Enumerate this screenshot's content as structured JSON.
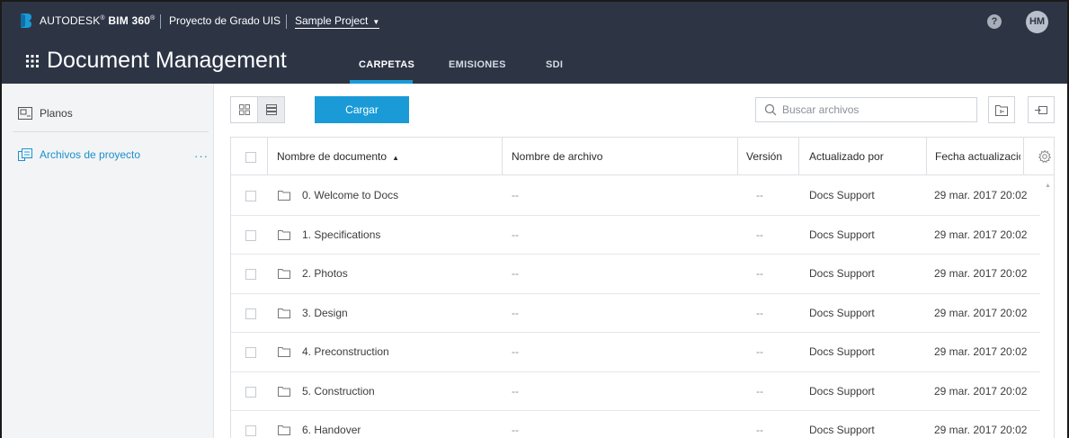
{
  "header": {
    "brand_prefix": "AUTODESK",
    "brand_product": "BIM 360",
    "brand_mark": "®",
    "project_group": "Proyecto de Grado UIS",
    "project_selector": "Sample Project",
    "help_glyph": "?",
    "user_initials": "HM",
    "app_title": "Document Management",
    "tabs": [
      {
        "label": "CARPETAS",
        "active": true
      },
      {
        "label": "EMISIONES",
        "active": false
      },
      {
        "label": "SDI",
        "active": false
      }
    ],
    "colors": {
      "header_bg": "#2d3545",
      "accent": "#1a9ad6"
    }
  },
  "sidebar": {
    "items": [
      {
        "label": "Planos",
        "icon": "sheets-icon"
      },
      {
        "label": "Archivos de proyecto",
        "icon": "project-files-icon",
        "active": true
      }
    ],
    "more_glyph": "···"
  },
  "toolbar": {
    "upload_label": "Cargar",
    "search_placeholder": "Buscar archivos"
  },
  "table": {
    "columns": [
      {
        "label": "Nombre de documento",
        "sorted": "asc"
      },
      {
        "label": "Nombre de archivo"
      },
      {
        "label": "Versión"
      },
      {
        "label": "Actualizado por"
      },
      {
        "label": "Fecha actualización"
      }
    ],
    "rows": [
      {
        "name": "0. Welcome to Docs",
        "file": "--",
        "version": "--",
        "updated_by": "Docs Support",
        "date": "29 mar. 2017 20:02"
      },
      {
        "name": "1. Specifications",
        "file": "--",
        "version": "--",
        "updated_by": "Docs Support",
        "date": "29 mar. 2017 20:02"
      },
      {
        "name": "2. Photos",
        "file": "--",
        "version": "--",
        "updated_by": "Docs Support",
        "date": "29 mar. 2017 20:02"
      },
      {
        "name": "3. Design",
        "file": "--",
        "version": "--",
        "updated_by": "Docs Support",
        "date": "29 mar. 2017 20:02"
      },
      {
        "name": "4. Preconstruction",
        "file": "--",
        "version": "--",
        "updated_by": "Docs Support",
        "date": "29 mar. 2017 20:02"
      },
      {
        "name": "5. Construction",
        "file": "--",
        "version": "--",
        "updated_by": "Docs Support",
        "date": "29 mar. 2017 20:02"
      },
      {
        "name": "6. Handover",
        "file": "--",
        "version": "--",
        "updated_by": "Docs Support",
        "date": "29 mar. 2017 20:02"
      }
    ]
  }
}
